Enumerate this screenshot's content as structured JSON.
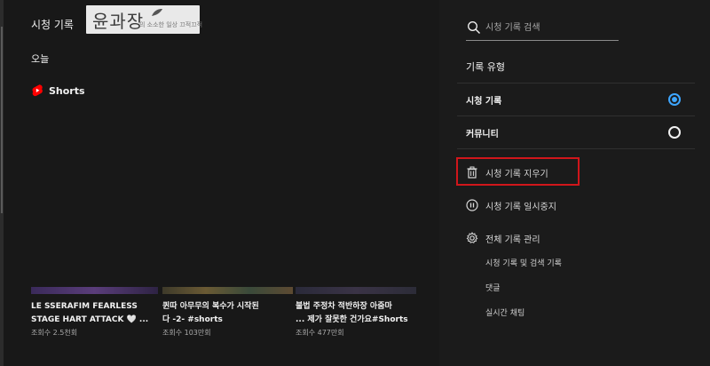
{
  "header": {
    "title": "시청 기록"
  },
  "watermark": {
    "title": "윤과장",
    "subtitle": "의 소소한 일상 끄적끄적"
  },
  "history": {
    "section_label": "오늘",
    "shorts_label": "Shorts",
    "cards": [
      {
        "title_line1": "LE SSERAFIM FEARLESS",
        "title_line2": "STAGE HART ATTACK 🤍 ...",
        "views": "조회수 2.5천회"
      },
      {
        "title_line1": "퀸따 아무무의 복수가 시작된",
        "title_line2": "다 -2- #shorts",
        "views": "조회수 103만회"
      },
      {
        "title_line1": "불법 주정차 적반하장 아줌마",
        "title_line2": "... 제가 잘못한 건가요#Shorts",
        "views": "조회수 477만회"
      }
    ]
  },
  "sidebar": {
    "search": {
      "placeholder": "시청 기록 검색",
      "value": ""
    },
    "filter_heading": "기록 유형",
    "options": [
      {
        "label": "시청 기록",
        "checked": true
      },
      {
        "label": "커뮤니티",
        "checked": false
      }
    ],
    "actions": {
      "clear": "시청 기록 지우기",
      "pause": "시청 기록 일시중지",
      "manage": "전체 기록 관리"
    },
    "manage_items": [
      "시청 기록 및 검색 기록",
      "댓글",
      "실시간 채팅"
    ]
  },
  "colors": {
    "accent": "#3ea6ff",
    "highlight": "#d0161b",
    "shorts_red": "#ff0000",
    "background": "#181818"
  }
}
